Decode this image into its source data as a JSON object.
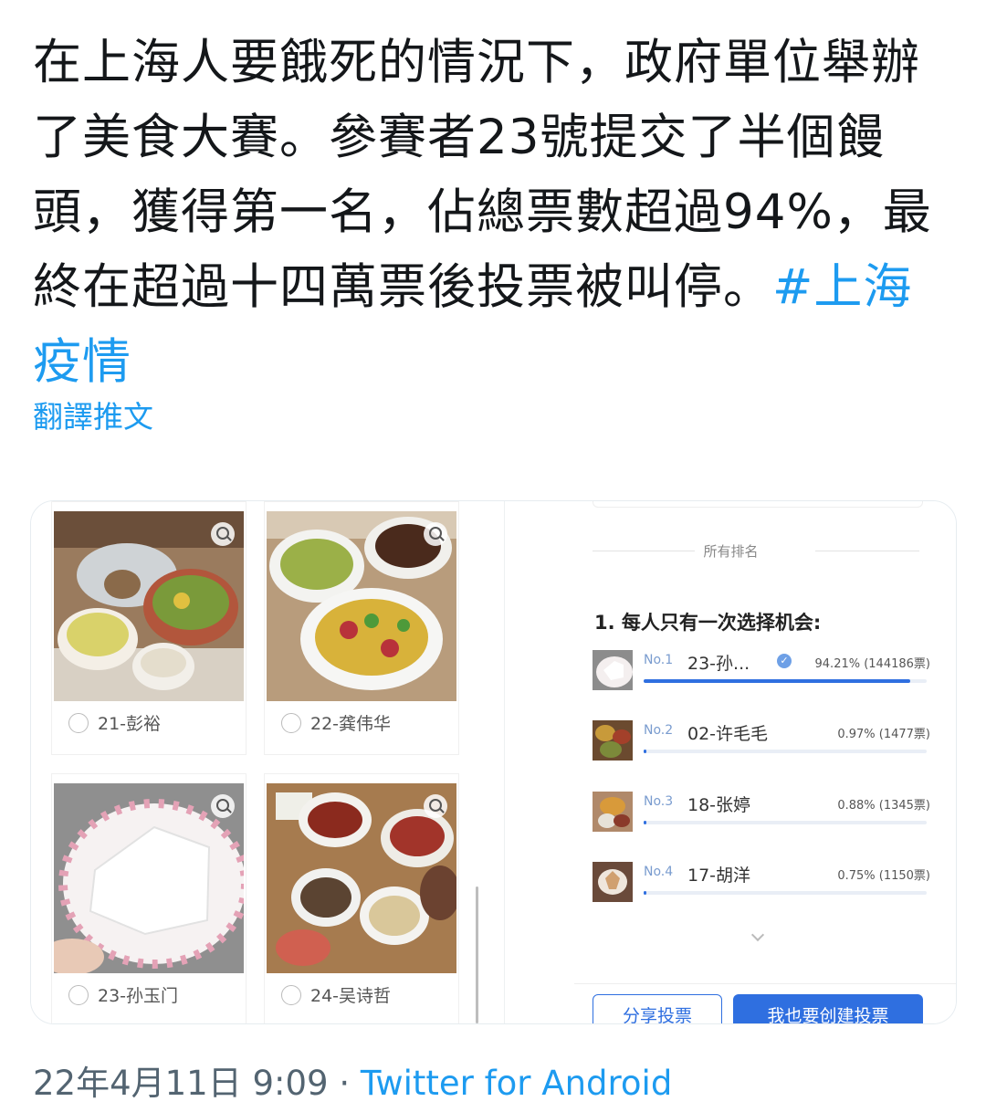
{
  "tweet": {
    "text": "在上海人要餓死的情況下，政府單位舉辦了美食大賽。參賽者23號提交了半個饅頭，獲得第一名，佔總票數超過94%，最終在超過十四萬票後投票被叫停。",
    "hashtag": "#上海疫情",
    "translate_label": "翻譯推文"
  },
  "left_panel": {
    "candidates": [
      {
        "label": "21-彭裕"
      },
      {
        "label": "22-龚伟华"
      },
      {
        "label": "23-孙玉门"
      },
      {
        "label": "24-吴诗哲"
      }
    ]
  },
  "right_panel": {
    "section_title": "所有排名",
    "question": "1. 每人只有一次选择机会:",
    "rankings": [
      {
        "no": "No.1",
        "name": "23-孙...",
        "percent": "94.21% (144186票)",
        "share": 0.9421
      },
      {
        "no": "No.2",
        "name": "02-许毛毛",
        "percent": "0.97% (1477票)",
        "share": 0.0097
      },
      {
        "no": "No.3",
        "name": "18-张婷",
        "percent": "0.88% (1345票)",
        "share": 0.0088
      },
      {
        "no": "No.4",
        "name": "17-胡洋",
        "percent": "0.75% (1150票)",
        "share": 0.0075
      }
    ],
    "share_button": "分享投票",
    "create_button": "我也要创建投票"
  },
  "footer": {
    "time": "22年4月11日 9:09",
    "separator": " · ",
    "source": "Twitter for Android"
  },
  "colors": {
    "link": "#1d9bf0",
    "accent": "#2f6fe0"
  }
}
